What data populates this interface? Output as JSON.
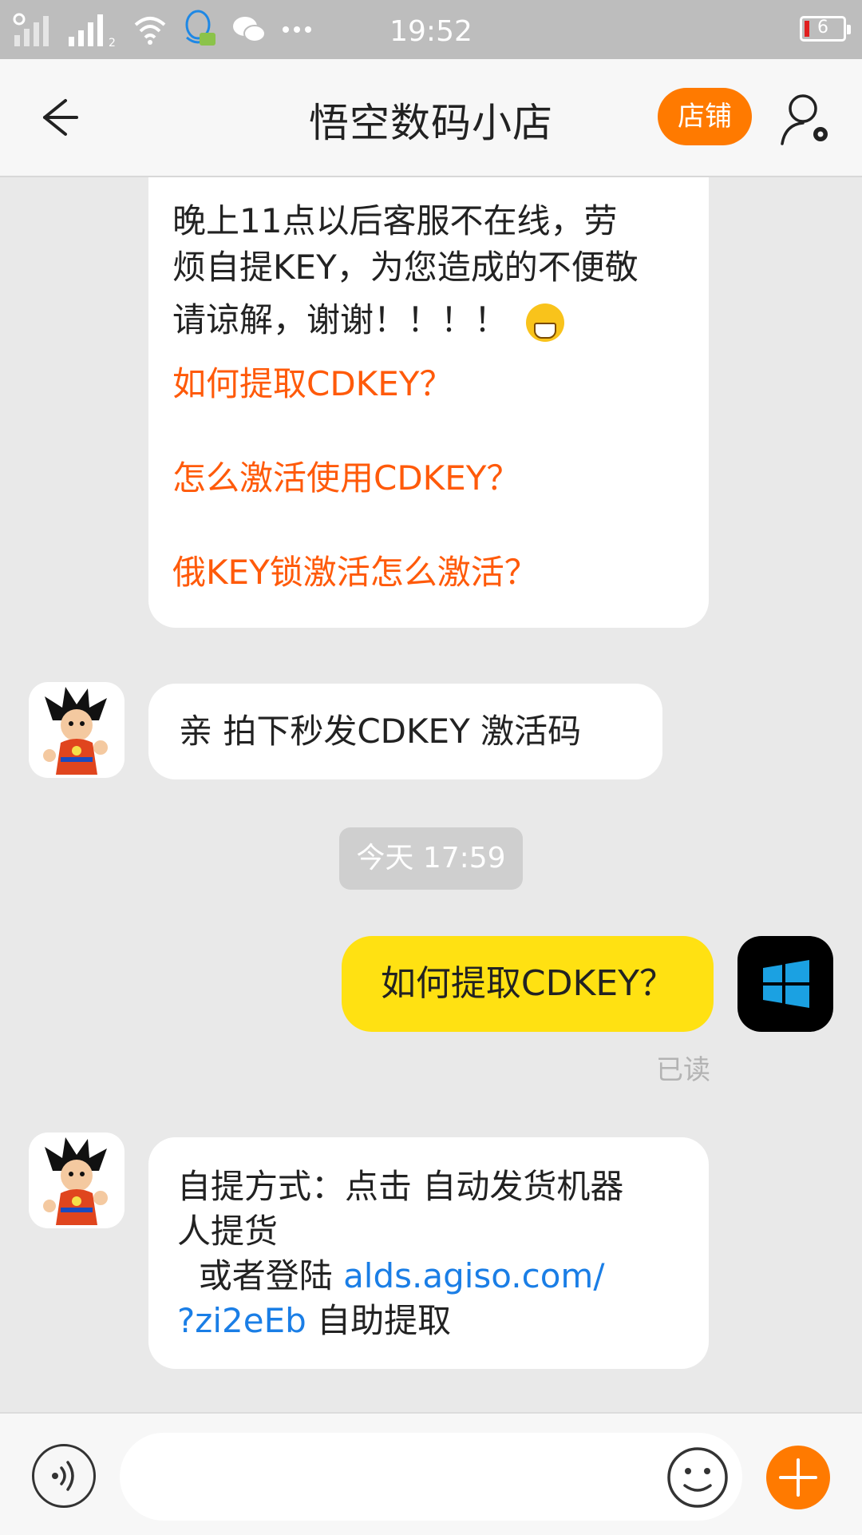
{
  "status_bar": {
    "time": "19:52",
    "battery_level": "6",
    "icons": [
      "signal-off-icon",
      "signal-icon",
      "wifi-icon",
      "qq-icon",
      "wechat-icon",
      "more-icon"
    ]
  },
  "header": {
    "title": "悟空数码小店",
    "shop_label": "店铺",
    "back_icon": "back-arrow-icon",
    "profile_icon": "user-settings-icon"
  },
  "messages": [
    {
      "sender": "shop",
      "lines": [
        "晚上11点以后客服不在线，劳",
        "烦自提KEY，为您造成的不便敬",
        "请谅解，谢谢！！！！"
      ],
      "links": [
        "如何提取CDKEY？",
        "怎么激活使用CDKEY？",
        "俄KEY锁激活怎么激活？"
      ]
    },
    {
      "sender": "shop",
      "text": "亲  拍下秒发CDKEY 激活码"
    },
    {
      "timestamp": "今天 17:59"
    },
    {
      "sender": "me",
      "text": "如何提取CDKEY？",
      "status": "已读"
    },
    {
      "sender": "shop",
      "line1": "自提方式：点击 自动发货机器",
      "line2": "人提货",
      "line3_prefix": "  或者登陆 ",
      "link_a": "alds.agiso.com/",
      "link_b": "?zi2eEb",
      "line4_suffix": " 自助提取"
    }
  ],
  "input_bar": {
    "placeholder": "",
    "voice_icon": "voice-icon",
    "emoji_icon": "emoji-icon",
    "plus_icon": "plus-icon"
  },
  "colors": {
    "accent": "#ff7a00",
    "link_orange": "#ff5a0a",
    "link_blue": "#1a7ee6",
    "my_bubble": "#ffe112",
    "background": "#e9e9e9"
  }
}
